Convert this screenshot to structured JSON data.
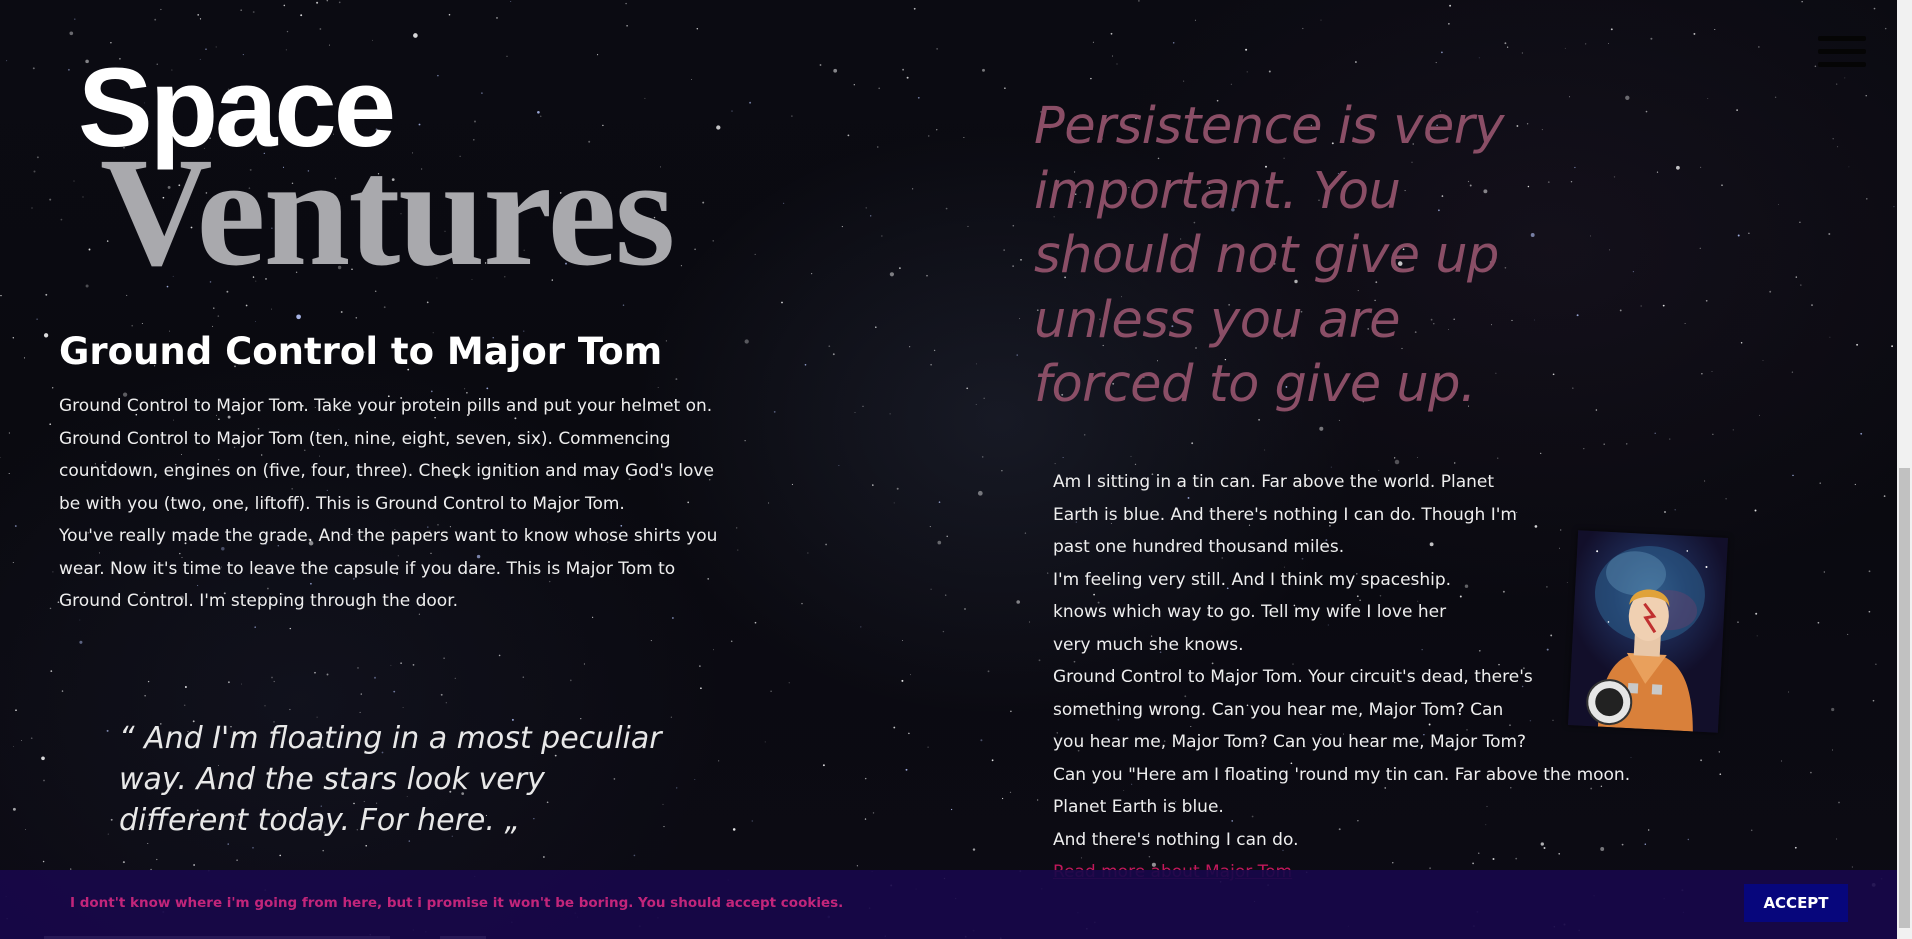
{
  "logo": {
    "line1": "Space",
    "line2": "Ventures"
  },
  "menu": {
    "icon": "hamburger-menu-icon"
  },
  "intro": {
    "heading": "Ground Control to Major Tom",
    "paragraphs": [
      "Ground Control to Major Tom. Take your protein pills and put your helmet on. Ground Control to Major Tom (ten, nine, eight, seven, six). Commencing countdown, engines on (five, four, three). Check ignition and may God's love be with you (two, one, liftoff). This is Ground Control to Major Tom.",
      "You've really made the grade. And the papers want to know whose shirts you wear. Now it's time to leave the capsule if you dare. This is Major Tom to Ground Control. I'm stepping through the door."
    ]
  },
  "blockquote": {
    "open_mark": "“",
    "text": "And I'm floating in a most peculiar way. And the stars look very different today. For here.",
    "close_mark": "„"
  },
  "quote_large": "Persistence is very important. You should not give up unless you are forced to give up.",
  "lyrics": {
    "lines": [
      "Am I sitting in a tin can. Far above the world. Planet",
      "Earth is blue. And there's nothing I can do. Though I'm",
      "past one hundred thousand miles.",
      "I'm feeling very still. And I think my spaceship.",
      "knows which way to go. Tell my wife I love her",
      "very much she knows.",
      "Ground Control to Major Tom. Your circuit's dead, there's",
      "something wrong. Can you hear me, Major Tom? Can",
      "you hear me, Major Tom? Can you hear me, Major Tom?",
      "Can you \"Here am I floating 'round my tin can. Far above the moon.",
      "Planet Earth is blue.",
      "And there's nothing I can do."
    ],
    "read_more": "Read more about Major Tom"
  },
  "image": {
    "alt": "astronaut-portrait"
  },
  "cookie_banner": {
    "text": "I dont't know where i'm going from here, but i promise it won't be boring. You should accept cookies.",
    "accept_label": "ACCEPT"
  },
  "colors": {
    "quote_large": "#8a4e66",
    "link": "#c2185b",
    "cookie_bg": "#18084a",
    "cookie_text": "#c2257a",
    "accept_bg": "#07067c"
  }
}
